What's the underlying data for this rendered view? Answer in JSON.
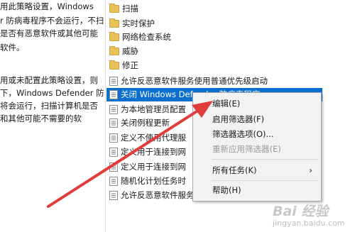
{
  "description_lines": [
    "用此策略设置，Windows",
    "r 防病毒程序不会运行，不扫",
    "是否有恶意软件或其他可能",
    "软件。",
    "",
    "用或未配置此策略设置，则",
    "下，Windows Defender 防",
    "将会运行，扫描计算机是否",
    "和其他可能不需要的软"
  ],
  "tree_items": [
    {
      "type": "folder",
      "label": "扫描"
    },
    {
      "type": "folder",
      "label": "实时保护"
    },
    {
      "type": "folder",
      "label": "网络检查系统"
    },
    {
      "type": "folder",
      "label": "威胁"
    },
    {
      "type": "folder",
      "label": "修正"
    },
    {
      "type": "policy",
      "label": "允许反恶意软件服务使用普通优先级启动"
    },
    {
      "type": "policy",
      "label": "关闭 Windows Defender 防病毒程序",
      "selected": true
    },
    {
      "type": "policy",
      "label": "为本地管理员配置"
    },
    {
      "type": "policy",
      "label": "关闭例程更新"
    },
    {
      "type": "policy",
      "label": "定义不使用代理服"
    },
    {
      "type": "policy",
      "label": "定义用于连接到网"
    },
    {
      "type": "policy",
      "label": "定义用于连接到网"
    },
    {
      "type": "policy",
      "label": "随机化计划任务时"
    },
    {
      "type": "policy",
      "label": "允许反恶意软件服务始终保持运行状态"
    }
  ],
  "context_menu": {
    "items": [
      {
        "label": "编辑(E)",
        "disabled": false
      },
      {
        "label": "启用筛选器(F)",
        "disabled": false
      },
      {
        "label": "筛选器选项(O)...",
        "disabled": false
      },
      {
        "label": "重新应用筛选器(E)",
        "disabled": true
      },
      {
        "label": "所有任务(K)",
        "disabled": false,
        "submenu_glyph": "›"
      },
      {
        "label": "帮助(H)",
        "disabled": false
      }
    ]
  },
  "watermark": {
    "main": "Bai 经验",
    "sub": "jingyan.baidu.com"
  },
  "colors": {
    "selection": "#0b6fd0",
    "arrow": "#e03c3c",
    "folder": "#e8c35a"
  }
}
